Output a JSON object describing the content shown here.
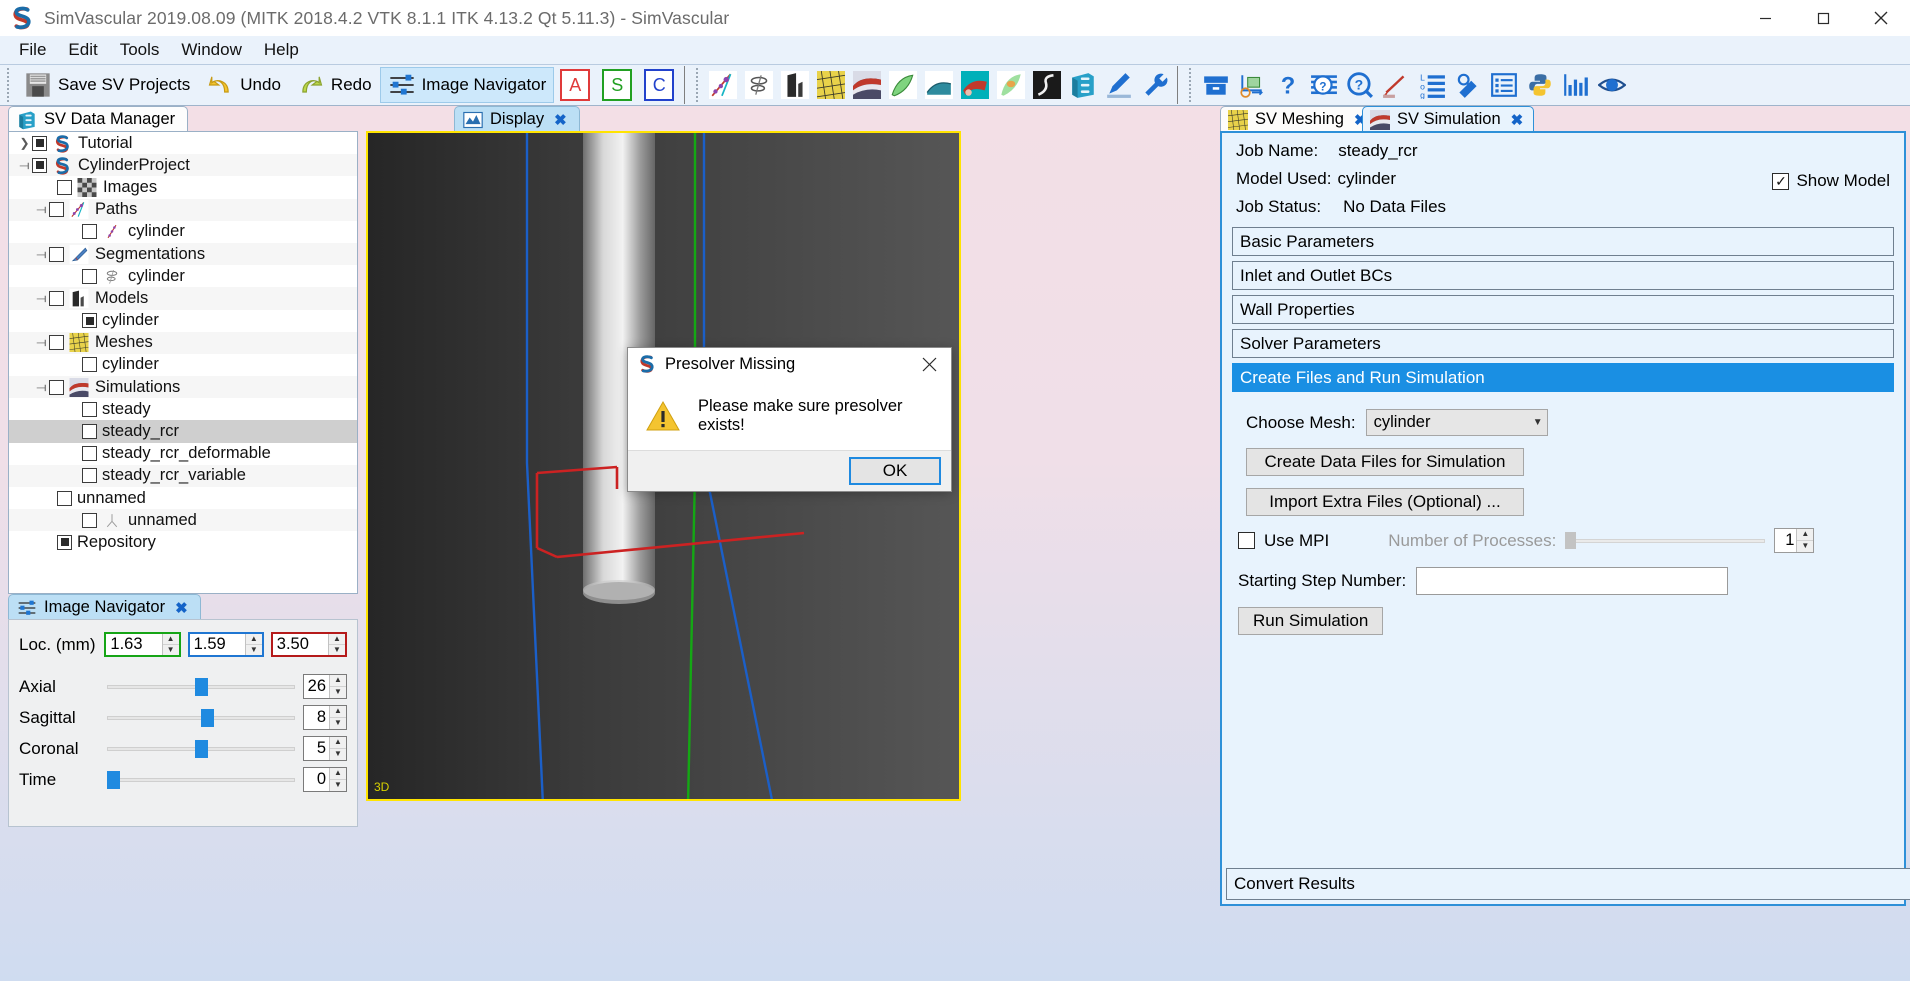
{
  "window": {
    "title": "SimVascular 2019.08.09 (MITK 2018.4.2 VTK 8.1.1 ITK 4.13.2 Qt 5.11.3) - SimVascular",
    "logo_icon": "simvascular-logo-icon",
    "minimize_icon": "minimize-icon",
    "maximize_icon": "maximize-icon",
    "close_icon": "close-icon"
  },
  "menubar": {
    "items": [
      {
        "label": "File"
      },
      {
        "label": "Edit"
      },
      {
        "label": "Tools"
      },
      {
        "label": "Window"
      },
      {
        "label": "Help"
      }
    ]
  },
  "toolbar": {
    "save_label": "Save SV Projects",
    "save_icon": "floppy-disk-icon",
    "undo_label": "Undo",
    "undo_icon": "undo-arrow-icon",
    "redo_label": "Redo",
    "redo_icon": "redo-arrow-icon",
    "navigator_label": "Image Navigator",
    "navigator_icon": "sliders-icon",
    "plane_buttons": [
      {
        "label": "A",
        "name": "axial-plane-button",
        "color": "#e03a3a"
      },
      {
        "label": "S",
        "name": "sagittal-plane-button",
        "color": "#22a022"
      },
      {
        "label": "C",
        "name": "coronal-plane-button",
        "color": "#2242cc"
      }
    ],
    "module_icons": [
      "path-planning-icon",
      "segmentation-2d-icon",
      "modeling-icon",
      "meshing-icon",
      "simulation-icon",
      "model-surface-icon",
      "svfsi-icon",
      "rom-simulation-icon",
      "image-processing-icon",
      "data-manager-icon",
      "segmentation-edit-icon",
      "tools-wrench-icon"
    ],
    "help_icons": [
      "archive-box-icon",
      "measurement-icon",
      "question-mark-icon",
      "context-help-icon",
      "help-circle-icon",
      "annotation-icon",
      "logging-icon",
      "screenshot-icon",
      "properties-icon",
      "python-console-icon",
      "histogram-icon",
      "visibility-eye-icon"
    ]
  },
  "left_dock": {
    "tab": {
      "label": "SV Data Manager",
      "icon": "data-manager-icon",
      "closable": false
    },
    "tree": [
      {
        "label": "Tutorial",
        "indent": 0,
        "arrow": "right",
        "checkbox": "filled",
        "icon": "simvascular-project-icon"
      },
      {
        "label": "CylinderProject",
        "indent": 0,
        "arrow": "down",
        "checkbox": "filled",
        "icon": "simvascular-project-icon"
      },
      {
        "label": "Images",
        "indent": 1,
        "arrow": "none",
        "checkbox": "empty",
        "icon": "images-folder-icon"
      },
      {
        "label": "Paths",
        "indent": 1,
        "arrow": "down",
        "checkbox": "empty",
        "icon": "paths-folder-icon"
      },
      {
        "label": "cylinder",
        "indent": 2,
        "arrow": "none",
        "checkbox": "empty",
        "icon": "path-item-icon"
      },
      {
        "label": "Segmentations",
        "indent": 1,
        "arrow": "down",
        "checkbox": "empty",
        "icon": "segmentations-folder-icon"
      },
      {
        "label": "cylinder",
        "indent": 2,
        "arrow": "none",
        "checkbox": "empty",
        "icon": "segmentation-item-icon"
      },
      {
        "label": "Models",
        "indent": 1,
        "arrow": "down",
        "checkbox": "empty",
        "icon": "models-folder-icon"
      },
      {
        "label": "cylinder",
        "indent": 2,
        "arrow": "none",
        "checkbox": "filled",
        "icon": "none"
      },
      {
        "label": "Meshes",
        "indent": 1,
        "arrow": "down",
        "checkbox": "empty",
        "icon": "meshes-folder-icon"
      },
      {
        "label": "cylinder",
        "indent": 2,
        "arrow": "none",
        "checkbox": "empty",
        "icon": "none"
      },
      {
        "label": "Simulations",
        "indent": 1,
        "arrow": "down",
        "checkbox": "empty",
        "icon": "simulations-folder-icon"
      },
      {
        "label": "steady",
        "indent": 2,
        "arrow": "none",
        "checkbox": "empty",
        "icon": "none"
      },
      {
        "label": "steady_rcr",
        "indent": 2,
        "arrow": "none",
        "checkbox": "empty",
        "icon": "none",
        "selected": true
      },
      {
        "label": "steady_rcr_deformable",
        "indent": 2,
        "arrow": "none",
        "checkbox": "empty",
        "icon": "none"
      },
      {
        "label": "steady_rcr_variable",
        "indent": 2,
        "arrow": "none",
        "checkbox": "empty",
        "icon": "none"
      },
      {
        "label": "unnamed",
        "indent": 1,
        "arrow": "none",
        "checkbox": "empty",
        "icon": "none"
      },
      {
        "label": "unnamed",
        "indent": 2,
        "arrow": "none",
        "checkbox": "empty",
        "icon": "rom-item-icon"
      },
      {
        "label": "Repository",
        "indent": 1,
        "arrow": "none",
        "checkbox": "filled",
        "icon": "none"
      }
    ]
  },
  "image_navigator": {
    "tab": {
      "label": "Image Navigator",
      "icon": "sliders-icon",
      "close": "✖"
    },
    "loc_label": "Loc. (mm)",
    "loc_values": [
      {
        "value": "1.63",
        "border": "#16a516",
        "name": "loc-axial-spinbox"
      },
      {
        "value": "1.59",
        "border": "#1f76d2",
        "name": "loc-sagittal-spinbox"
      },
      {
        "value": "3.50",
        "border": "#b51a1a",
        "name": "loc-coronal-spinbox"
      }
    ],
    "sliders": [
      {
        "label": "Axial",
        "value": "26",
        "pct": 47
      },
      {
        "label": "Sagittal",
        "value": "8",
        "pct": 50
      },
      {
        "label": "Coronal",
        "value": "5",
        "pct": 47
      },
      {
        "label": "Time",
        "value": "0",
        "pct": 0
      }
    ]
  },
  "display": {
    "tab": {
      "label": "Display",
      "icon": "display-icon",
      "close": "✖"
    },
    "viewport_label": "3D"
  },
  "right_dock": {
    "tabs": [
      {
        "label": "SV Meshing",
        "icon": "meshing-icon",
        "active": false,
        "close": "✖"
      },
      {
        "label": "SV Simulation",
        "icon": "simulation-icon",
        "active": true,
        "close": "✖"
      }
    ],
    "job_name_label": "Job Name:",
    "job_name_value": "steady_rcr",
    "model_used_label": "Model Used:",
    "model_used_value": "cylinder",
    "job_status_label": "Job Status:",
    "job_status_value": "No Data Files",
    "show_model_label": "Show Model",
    "show_model_checked": true,
    "sections": [
      {
        "label": "Basic Parameters",
        "expanded": false
      },
      {
        "label": "Inlet and Outlet BCs",
        "expanded": false
      },
      {
        "label": "Wall Properties",
        "expanded": false
      },
      {
        "label": "Solver Parameters",
        "expanded": false
      },
      {
        "label": "Create Files and Run Simulation",
        "expanded": true
      }
    ],
    "run_section": {
      "choose_mesh_label": "Choose Mesh:",
      "choose_mesh_value": "cylinder",
      "create_data_files_label": "Create Data Files for Simulation",
      "import_extra_files_label": "Import Extra Files (Optional) ...",
      "use_mpi_label": "Use MPI",
      "use_mpi_checked": false,
      "num_processes_label": "Number of Processes:",
      "num_processes_value": "1",
      "starting_step_label": "Starting Step Number:",
      "starting_step_value": "",
      "run_simulation_label": "Run Simulation"
    },
    "convert_results_label": "Convert Results"
  },
  "dialog": {
    "title": "Presolver Missing",
    "title_icon": "simvascular-logo-icon",
    "close_icon": "close-icon",
    "warning_icon": "warning-triangle-icon",
    "message": "Please make sure presolver exists!",
    "ok_label": "OK"
  },
  "colors": {
    "accent": "#1a8fe3",
    "viewport_border": "#ffe400",
    "tab_active": "#bcdff5",
    "dock_bg_top": "#f3dfe6",
    "dock_bg_bottom": "#cfdcf0"
  }
}
